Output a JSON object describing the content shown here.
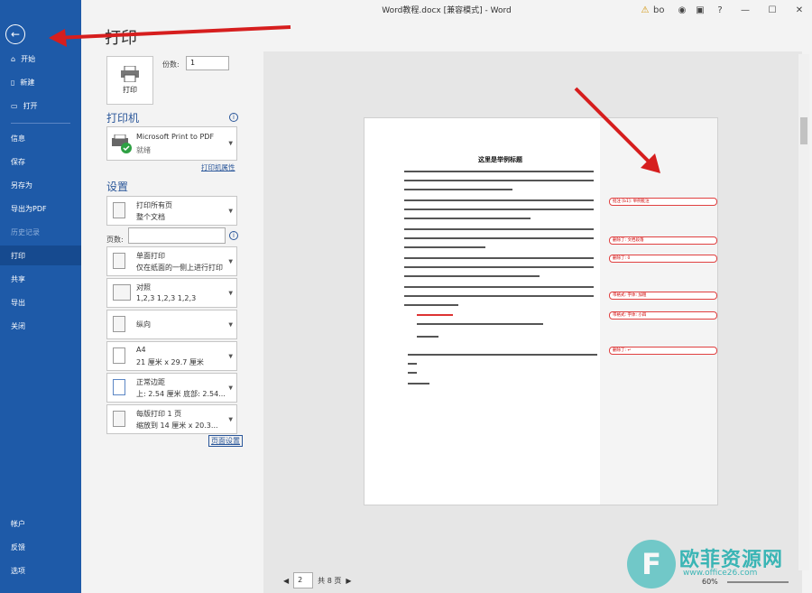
{
  "window": {
    "title": "Word教程.docx [兼容模式]  -  Word",
    "user_initials": "bo",
    "help_label": "?",
    "minimize_label": "—",
    "maximize_label": "☐",
    "close_label": "✕"
  },
  "sidebar": {
    "back_label": "←",
    "items": [
      {
        "label": "开始",
        "icon": "home-icon"
      },
      {
        "label": "新建",
        "icon": "new-doc-icon"
      },
      {
        "label": "打开",
        "icon": "open-folder-icon"
      },
      {
        "label": "信息"
      },
      {
        "label": "保存"
      },
      {
        "label": "另存为"
      },
      {
        "label": "导出为PDF"
      },
      {
        "label": "历史记录"
      },
      {
        "label": "打印"
      },
      {
        "label": "共享"
      },
      {
        "label": "导出"
      },
      {
        "label": "关闭"
      }
    ],
    "bottom_items": [
      {
        "label": "帐户"
      },
      {
        "label": "反馈"
      },
      {
        "label": "选项"
      }
    ]
  },
  "print": {
    "page_title": "打印",
    "print_button_label": "打印",
    "copies_label": "份数:",
    "copies_value": "1",
    "printer_section": "打印机",
    "printer_name": "Microsoft Print to PDF",
    "printer_status": "就绪",
    "printer_properties_link": "打印机属性",
    "settings_section": "设置",
    "pages_label": "页数:",
    "settings": [
      {
        "line1": "打印所有页",
        "line2": "整个文档"
      },
      {
        "line1": "单面打印",
        "line2": "仅在纸面的一侧上进行打印"
      },
      {
        "line1": "对照",
        "line2": "1,2,3     1,2,3     1,2,3"
      },
      {
        "line1": "纵向",
        "line2": ""
      },
      {
        "line1": "A4",
        "line2": "21 厘米 x 29.7 厘米"
      },
      {
        "line1": "正常边距",
        "line2": "上: 2.54 厘米 底部: 2.54..."
      },
      {
        "line1": "每版打印 1 页",
        "line2": "缩放到 14 厘米 x 20.3..."
      }
    ],
    "page_setup_link": "页面设置"
  },
  "preview": {
    "doc_title": "这里是举例标题",
    "comments": [
      "批注 [b1]: 举例批注",
      "删除了: 文档段落",
      "删除了: 0",
      "带格式: 字体: 加粗",
      "带格式: 字体: 小四",
      "删除了: ↵"
    ],
    "current_page": "2",
    "total_pages": "共 8 页",
    "zoom": "60%"
  },
  "watermark": {
    "logo_letter": "F",
    "text": "欧菲资源网",
    "url": "www.office26.com"
  }
}
